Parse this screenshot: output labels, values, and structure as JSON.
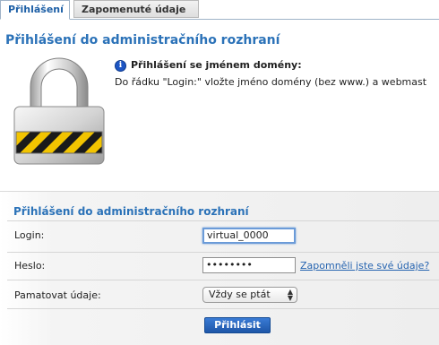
{
  "tabs": [
    {
      "label": "Přihlášení",
      "active": true
    },
    {
      "label": "Zapomenuté údaje",
      "active": false
    }
  ],
  "header": {
    "title": "Přihlášení do administračního rozhraní",
    "info_title": "Přihlášení se jménem domény:",
    "info_text": "Do řádku \"Login:\" vložte jméno domény (bez www.) a webmast"
  },
  "form": {
    "title": "Přihlášení do administračního rozhraní",
    "login_label": "Login:",
    "login_value": "virtual_0000",
    "password_label": "Heslo:",
    "password_value": "••••••••",
    "forgot_link": "Zapomněli jste své údaje?",
    "remember_label": "Pamatovat údaje:",
    "remember_selected": "Vždy se ptát",
    "submit_label": "Přihlásit"
  },
  "icons": {
    "info": "info-icon",
    "lock": "padlock-icon",
    "select_arrows": "updown-arrows-icon"
  },
  "colors": {
    "accent": "#2b72b8",
    "link": "#2664b0",
    "button": "#1e56a8"
  }
}
